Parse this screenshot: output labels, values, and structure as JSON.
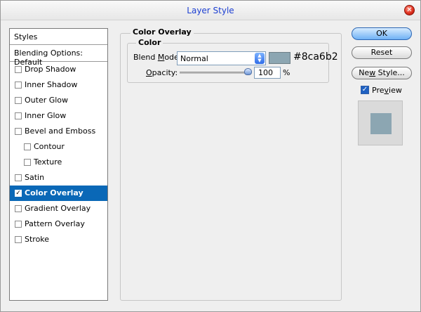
{
  "window": {
    "title": "Layer Style",
    "close_symbol": "✕"
  },
  "styles_panel": {
    "header": "Styles",
    "blending_options": "Blending Options: Default",
    "items": [
      {
        "label": "Drop Shadow",
        "checked": false
      },
      {
        "label": "Inner Shadow",
        "checked": false
      },
      {
        "label": "Outer Glow",
        "checked": false
      },
      {
        "label": "Inner Glow",
        "checked": false
      },
      {
        "label": "Bevel and Emboss",
        "checked": false
      },
      {
        "label": "Contour",
        "checked": false
      },
      {
        "label": "Texture",
        "checked": false
      },
      {
        "label": "Satin",
        "checked": false
      },
      {
        "label": "Color Overlay",
        "checked": true,
        "selected": true
      },
      {
        "label": "Gradient Overlay",
        "checked": false
      },
      {
        "label": "Pattern Overlay",
        "checked": false
      },
      {
        "label": "Stroke",
        "checked": false
      }
    ]
  },
  "overlay": {
    "section_title": "Color Overlay",
    "group_title": "Color",
    "blend_mode_label_prefix": "Blend ",
    "blend_mode_label_underline": "M",
    "blend_mode_label_suffix": "ode:",
    "blend_mode_value": "Normal",
    "color_hex": "#8ca6b2",
    "color_text": "#8ca6b2",
    "opacity_label_underline": "O",
    "opacity_label_suffix": "pacity:",
    "opacity_value": "100",
    "opacity_unit": "%",
    "opacity_fraction": 1.0
  },
  "buttons": {
    "ok": "OK",
    "reset": "Reset",
    "new_style_prefix": "Ne",
    "new_style_underline": "w",
    "new_style_suffix": " Style...",
    "preview_label_prefix": "Pre",
    "preview_label_underline": "v",
    "preview_label_suffix": "iew",
    "preview_checked": true,
    "check_symbol": "✓"
  },
  "icons": {
    "close": "close-icon",
    "select_arrows": "updown-arrows-icon",
    "checkbox": "checkbox-icon"
  },
  "colors": {
    "title_blue": "#1c3fd2",
    "selection_blue": "#0a68b7",
    "overlay_color": "#8ca6b2"
  }
}
